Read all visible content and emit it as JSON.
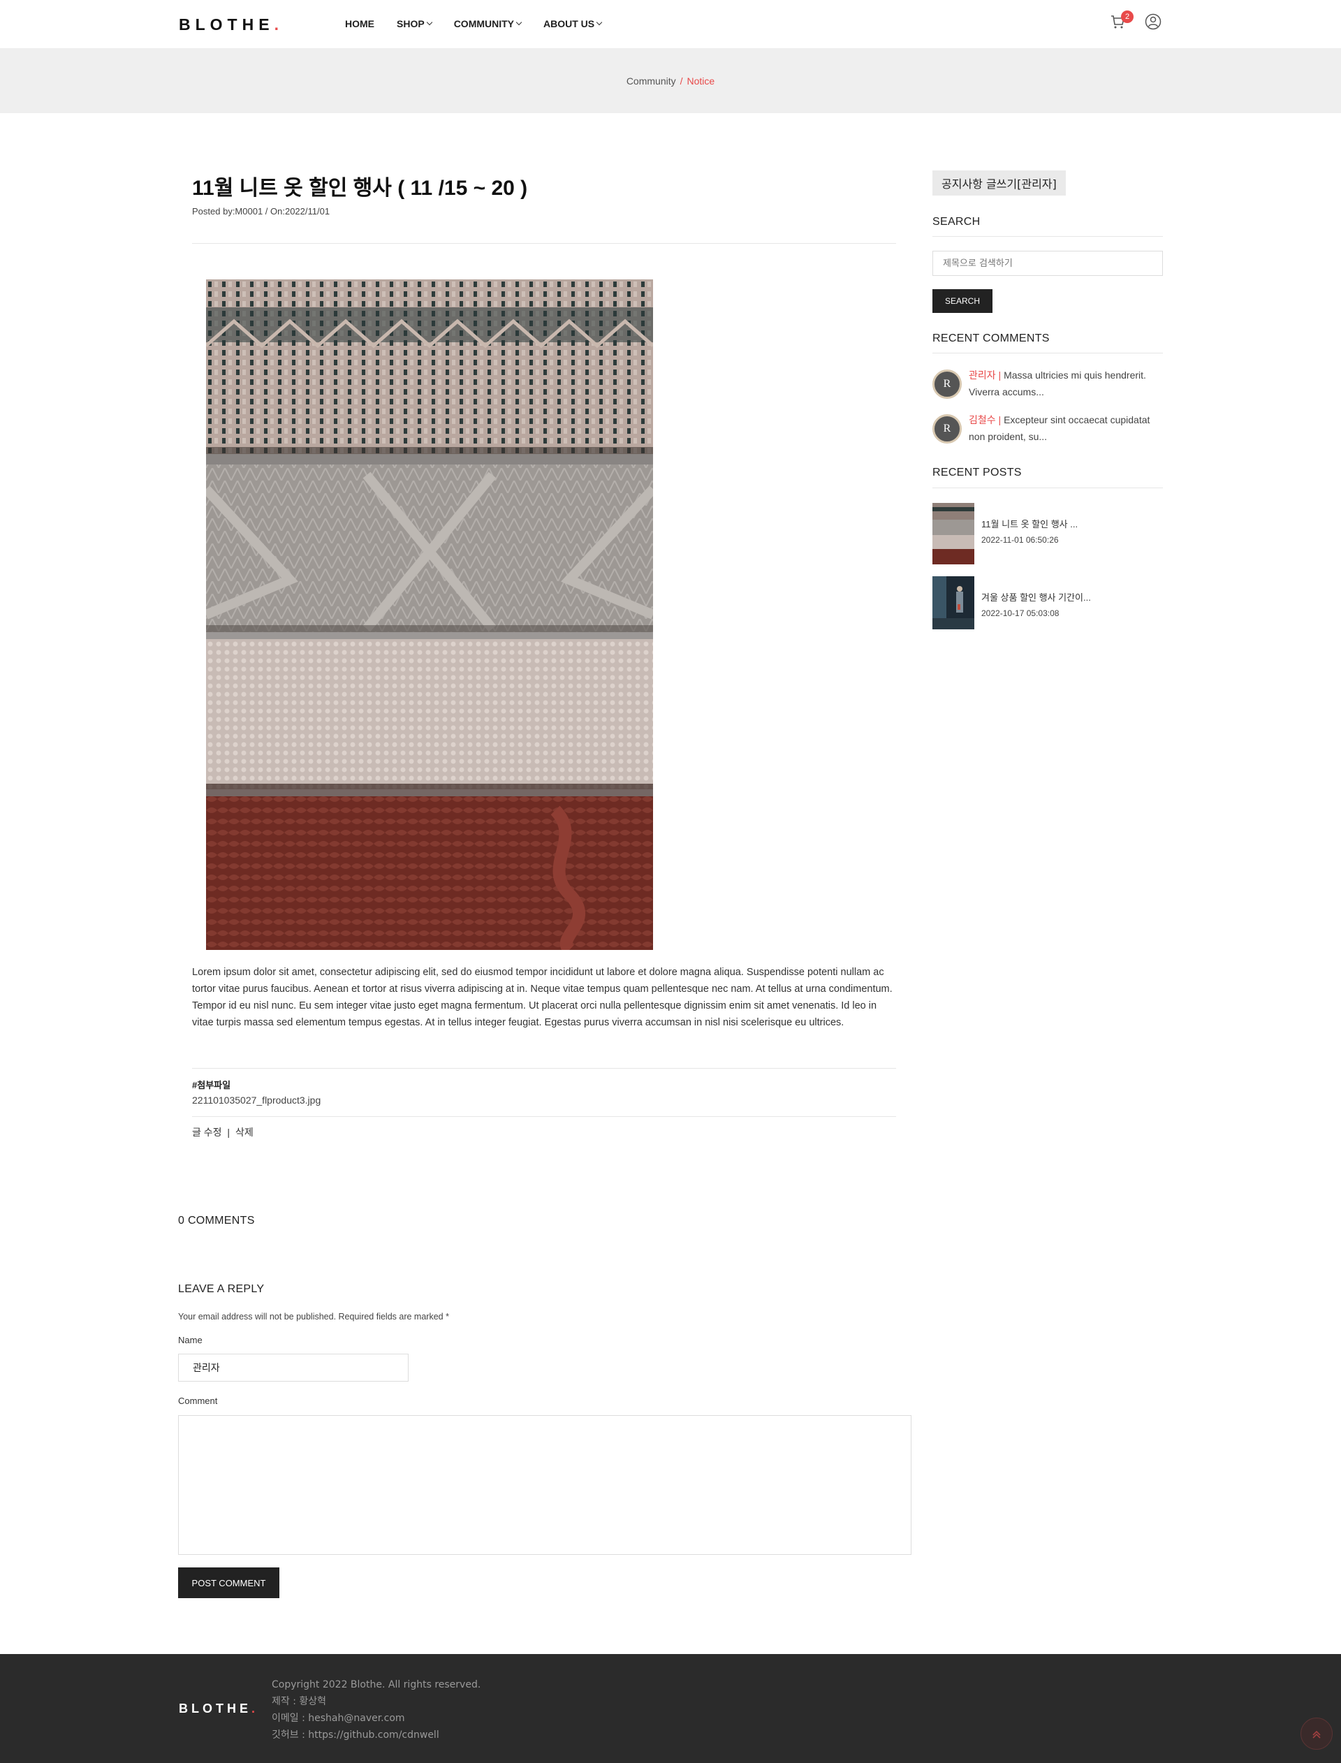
{
  "header": {
    "logo": "BLOTHE",
    "logo_dot": ".",
    "nav": [
      {
        "label": "HOME"
      },
      {
        "label": "SHOP"
      },
      {
        "label": "COMMUNITY"
      },
      {
        "label": "ABOUT US"
      }
    ],
    "cart_count": "2",
    "icons": [
      "cart-icon",
      "user-icon"
    ]
  },
  "breadcrumb": {
    "parent": "Community",
    "separator": "/",
    "current": "Notice"
  },
  "post": {
    "title": "11월 니트 옷 할인 행사 ( 11 /15 ~ 20 )",
    "meta": "Posted by:M0001 / On:2022/11/01",
    "body": "Lorem ipsum dolor sit amet, consectetur adipiscing elit, sed do eiusmod tempor incididunt ut labore et dolore magna aliqua. Suspendisse potenti nullam ac tortor vitae purus faucibus. Aenean et tortor at risus viverra adipiscing at in. Neque vitae tempus quam pellentesque nec nam. At tellus at urna condimentum. Tempor id eu nisl nunc. Eu sem integer vitae justo eget magna fermentum. Ut placerat orci nulla pellentesque dignissim enim sit amet venenatis. Id leo in vitae turpis massa sed elementum tempus egestas. At in tellus integer feugiat. Egestas purus viverra accumsan in nisl nisi scelerisque eu ultrices.",
    "attachment_heading": "#첨부파일",
    "attachment_file": "221101035027_flproduct3.jpg",
    "edit_label": "글 수정",
    "edit_sep": "|",
    "delete_label": "삭제"
  },
  "comments": {
    "count_label": "0 COMMENTS"
  },
  "reply": {
    "heading": "LEAVE A REPLY",
    "note": "Your email address will not be published. Required fields are marked *",
    "name_label": "Name",
    "name_value": "관리자",
    "comment_label": "Comment",
    "submit_label": "POST COMMENT"
  },
  "sidebar": {
    "write_button": "공지사항 글쓰기[관리자]",
    "search_heading": "SEARCH",
    "search_placeholder": "제목으로 검색하기",
    "search_button": "SEARCH",
    "recent_comments_heading": "RECENT COMMENTS",
    "recent_comments": [
      {
        "avatar": "R",
        "author": "관리자",
        "sep": " | ",
        "text": "Massa ultricies mi quis hendrerit. Viverra accums..."
      },
      {
        "avatar": "R",
        "author": "김철수",
        "sep": " | ",
        "text": "Excepteur sint occaecat cupidatat non proident, su..."
      }
    ],
    "recent_posts_heading": "RECENT POSTS",
    "recent_posts": [
      {
        "title": "11월 니트 옷 할인 행사 ...",
        "date": "2022-11-01 06:50:26"
      },
      {
        "title": "겨울 상품 할인 행사 기간이...",
        "date": "2022-10-17 05:03:08"
      }
    ]
  },
  "footer": {
    "logo": "BLOTHE",
    "logo_dot": ".",
    "lines": [
      "Copyright 2022 Blothe. All rights reserved.",
      "제작 : 황상혁",
      "이메일 : heshah@naver.com",
      "깃허브 : https://github.com/cdnwell"
    ],
    "totop_icon": "chevron-up-icon"
  },
  "colors": {
    "accent": "#e84a4a",
    "dark": "#222222",
    "footer_bg": "#2b2b2b",
    "breadcrumb_bg": "#efefef"
  }
}
